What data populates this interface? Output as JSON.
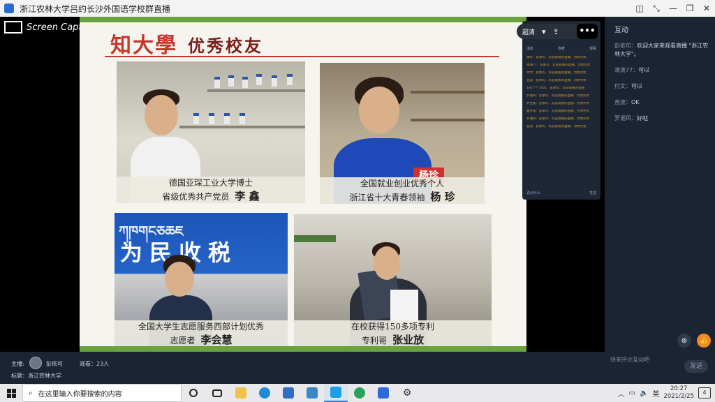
{
  "window": {
    "title": "浙江农林大学吕约长沙外国语学校群直播",
    "controls": [
      "◫",
      "⤡",
      "—",
      "❐",
      "✕"
    ]
  },
  "watermark": "Screen Capture Pro",
  "slide": {
    "logo": "知大學",
    "heading": "优秀校友",
    "photos": [
      {
        "line1": "德国亚琛工业大学博士",
        "line2_prefix": "省级优秀共产党员",
        "name": "李 鑫"
      },
      {
        "line1": "全国就业创业优秀个人",
        "line2_prefix": "浙江省十大青春领袖",
        "name": "杨 珍",
        "tag": "杨珍"
      },
      {
        "line1": "全国大学生志愿服务西部计划优秀",
        "line2_prefix": "志愿者",
        "name": "李会慧",
        "sign": "为民收税"
      },
      {
        "line1": "在校获得150多项专利",
        "line2_prefix": "专利哥",
        "name": "张业放"
      }
    ]
  },
  "overlay": {
    "quality": "超清",
    "more": "•••",
    "tabs": [
      "消息",
      "连麦",
      "观看"
    ],
    "messages": [
      "播叶：彭依可、欢迎观看的直播、为你点赞",
      "滴滴77：彭依可、欢迎观看的直播、为你点赞",
      "付文：彭依可、欢迎观看的直播、为你点赞",
      "直波：彭依可、欢迎观看的直播、为你点赞",
      "191****7001：彭依可、欢迎观看的直播",
      "罗湘风：彭依可、欢迎观看的直播、为你点赞",
      "尹连松：彭依可、欢迎观看的直播、为你点赞",
      "曲环发：彭依可、欢迎观看的直播、为你点赞",
      "罗湘风：彭依可、欢迎观看的直播、为你点赞",
      "直波：彭依可、欢迎观看的直播、为你点赞"
    ],
    "foot_left": "说点什么",
    "foot_right": "发送"
  },
  "sidebar": {
    "title": "互动",
    "comments": [
      {
        "user": "彭依可：",
        "text": "欢迎大家来观看直播 \"浙江农林大学\"。"
      },
      {
        "user": "滴滴77：",
        "text": "可以"
      },
      {
        "user": "付文：",
        "text": "可以"
      },
      {
        "user": "直波：",
        "text": "OK"
      },
      {
        "user": "罗湘风：",
        "text": "好哒"
      }
    ]
  },
  "info": {
    "host_label": "主播:",
    "host": "彭依可",
    "views": "观看：23人",
    "tag": "标题：浙江农林大学",
    "comment_placeholder": "快来评论互动吧",
    "send": "发送"
  },
  "taskbar": {
    "search_placeholder": "在这里输入你要搜索的内容",
    "lang": "英",
    "time": "20:27",
    "date": "2021/2/25",
    "notif_count": "4"
  },
  "colors": {
    "accent_green": "#6aa23e",
    "logo_red": "#c0392b",
    "sidebar_bg": "#1b2433"
  }
}
